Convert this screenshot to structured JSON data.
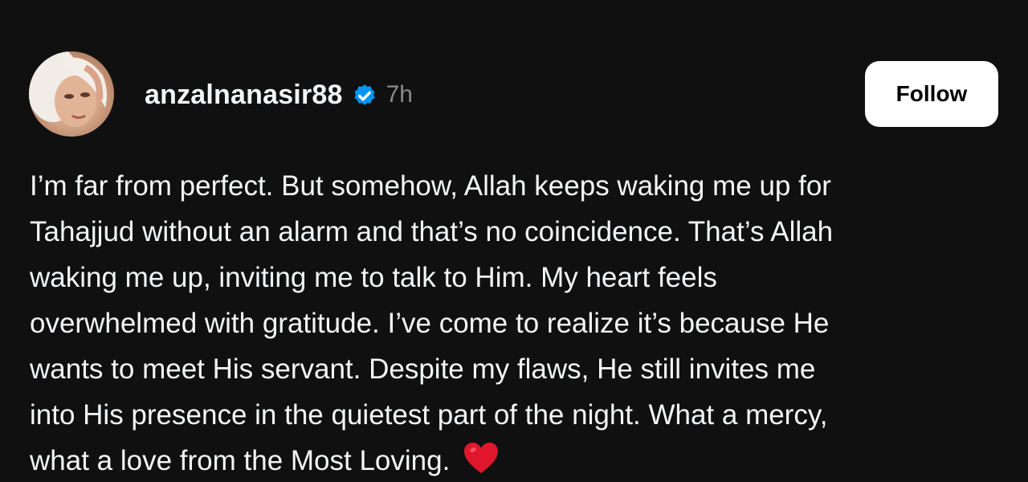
{
  "post": {
    "author": {
      "username": "anzalnanasir88",
      "verified": true,
      "time_ago": "7h",
      "avatar_icon": "profile-photo"
    },
    "follow_label": "Follow",
    "text_lines": [
      "I’m far from perfect. But somehow, Allah keeps waking me up for",
      "Tahajjud without an alarm and that’s no coincidence. That’s Allah",
      "waking me up, inviting me to talk to Him. My heart feels",
      "overwhelmed with gratitude. I’ve come to realize it’s because He",
      "wants to meet His servant. Despite my flaws, He still invites me",
      "into His presence in the quietest part of the night. What a mercy,",
      "what a love from the Most Loving."
    ],
    "emoji": "heart-icon"
  },
  "colors": {
    "background": "#101010",
    "text": "#f3f5f7",
    "muted": "#8a8a8a",
    "verified_badge": "#0095f6",
    "heart": "#e0172c",
    "button_bg": "#ffffff",
    "button_text": "#000000"
  }
}
